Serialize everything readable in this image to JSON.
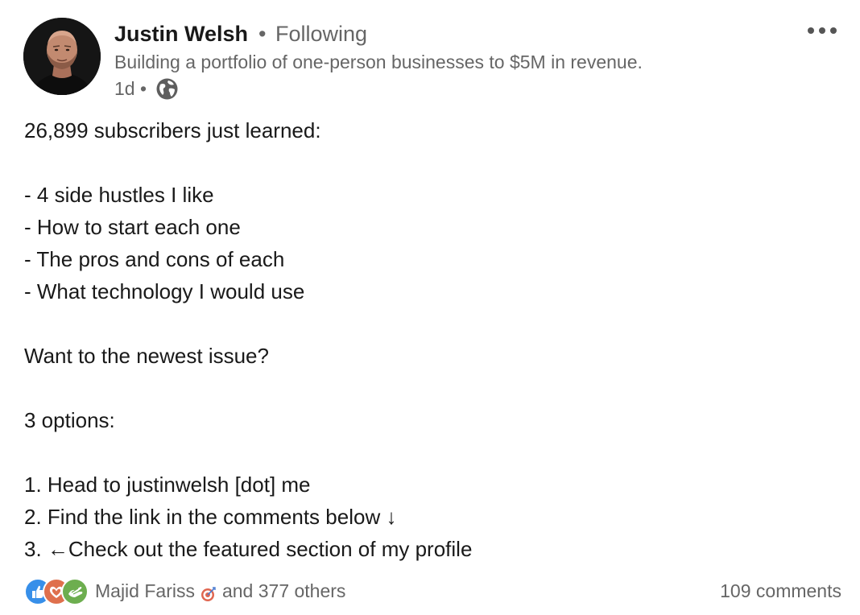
{
  "author": {
    "name": "Justin Welsh",
    "separator": "•",
    "follow_status": "Following",
    "headline": "Building a portfolio of one-person businesses to $5M in revenue.",
    "time_ago": "1d",
    "meta_separator": "•",
    "visibility_icon": "globe-icon",
    "avatar_icon": "profile-photo"
  },
  "menu": {
    "icon": "more-horizontal-icon"
  },
  "post": {
    "lines": [
      "26,899 subscribers just learned:",
      "",
      "- 4 side hustles I like",
      "- How to start each one",
      "- The pros and cons of each",
      "- What technology I would use",
      "",
      "Want to the newest issue?",
      "",
      "3 options:",
      "",
      "1. Head to justinwelsh [dot] me",
      "2. Find the link in the comments below ↓",
      "3. ←Check out the featured section of my profile"
    ]
  },
  "social": {
    "reaction_icons": [
      "like-icon",
      "love-icon",
      "support-icon"
    ],
    "reactor_name": "Majid Fariss",
    "reactor_badge_icon": "target-icon",
    "others_text": "and 377 others",
    "comments_text": "109 comments"
  },
  "colors": {
    "text_primary": "#191919",
    "text_secondary": "#666666",
    "like": "#378fe9",
    "love": "#df704d",
    "support": "#6dae4f"
  }
}
